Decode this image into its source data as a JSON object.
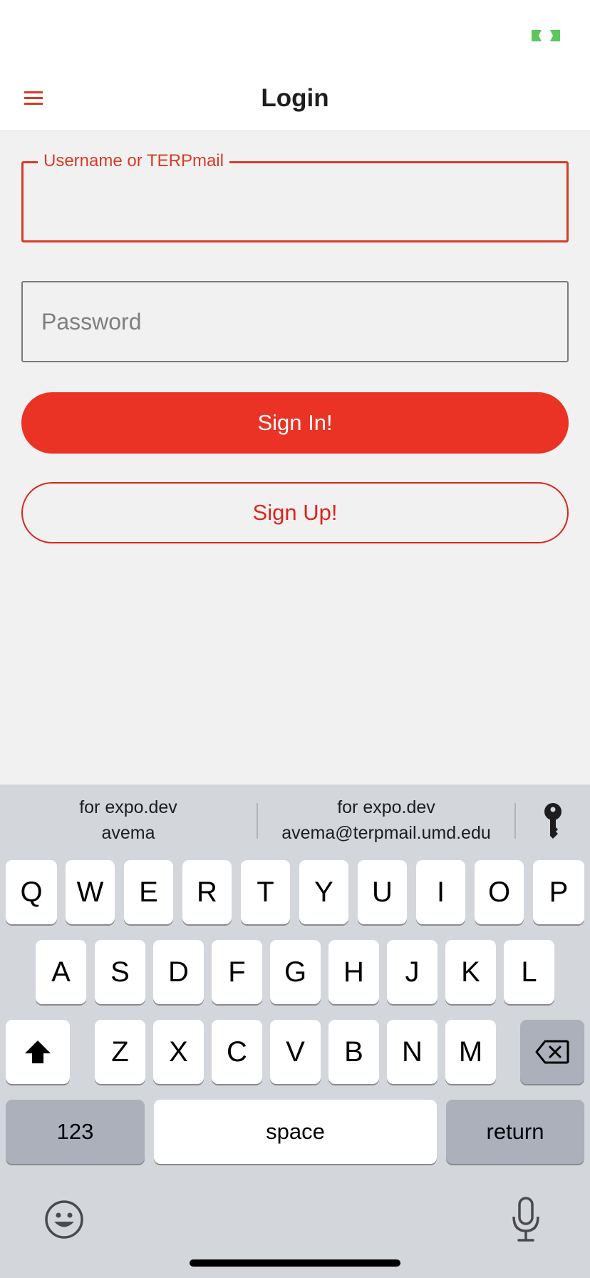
{
  "header": {
    "title": "Login",
    "menu_icon": "hamburger-menu-icon",
    "status_indicator_icon": "expo-dev-indicator-icon",
    "accent_color": "#d73b25",
    "indicator_color": "#5cc75c"
  },
  "form": {
    "username": {
      "label": "Username or TERPmail",
      "value": "",
      "focused": true
    },
    "password": {
      "placeholder": "Password",
      "value": ""
    },
    "sign_in_label": "Sign In!",
    "sign_up_label": "Sign Up!",
    "primary_color": "#ea3324"
  },
  "keyboard": {
    "suggestions": [
      {
        "line1": "for expo.dev",
        "line2": "avema"
      },
      {
        "line1": "for expo.dev",
        "line2": "avema@terpmail.umd.edu"
      }
    ],
    "passwords_icon": "key-icon",
    "rows": [
      [
        "Q",
        "W",
        "E",
        "R",
        "T",
        "Y",
        "U",
        "I",
        "O",
        "P"
      ],
      [
        "A",
        "S",
        "D",
        "F",
        "G",
        "H",
        "J",
        "K",
        "L"
      ],
      [
        "Z",
        "X",
        "C",
        "V",
        "B",
        "N",
        "M"
      ]
    ],
    "shift_icon": "shift-icon",
    "delete_icon": "backspace-icon",
    "numbers_label": "123",
    "space_label": "space",
    "return_label": "return",
    "emoji_icon": "emoji-icon",
    "mic_icon": "microphone-icon"
  }
}
